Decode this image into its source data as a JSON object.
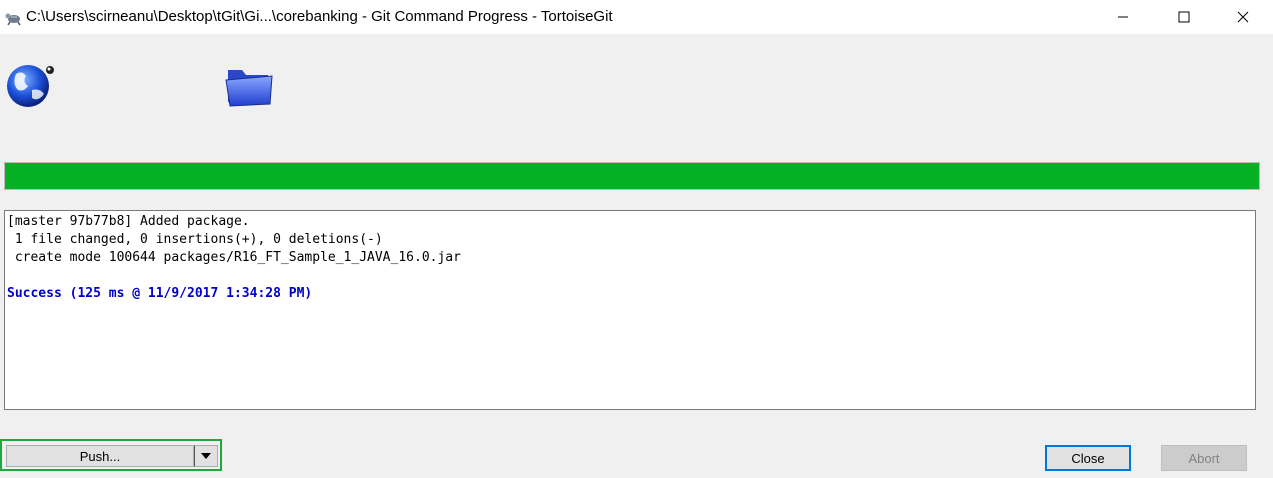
{
  "window": {
    "title": "C:\\Users\\scirneanu\\Desktop\\tGit\\Gi...\\corebanking - Git Command Progress - TortoiseGit"
  },
  "icons": {
    "app": "tortoise-app-icon",
    "globe": "globe-icon",
    "folder": "folder-icon"
  },
  "progress": {
    "percent": 100,
    "color": "#06b025"
  },
  "log": {
    "lines": [
      "[master 97b77b8] Added package.",
      " 1 file changed, 0 insertions(+), 0 deletions(-)",
      " create mode 100644 packages/R16_FT_Sample_1_JAVA_16.0.jar",
      "",
      "Success (125 ms @ 11/9/2017 1:34:28 PM)"
    ],
    "success_color": "#0000cc"
  },
  "buttons": {
    "push_label": "Push...",
    "close_label": "Close",
    "abort_label": "Abort"
  }
}
